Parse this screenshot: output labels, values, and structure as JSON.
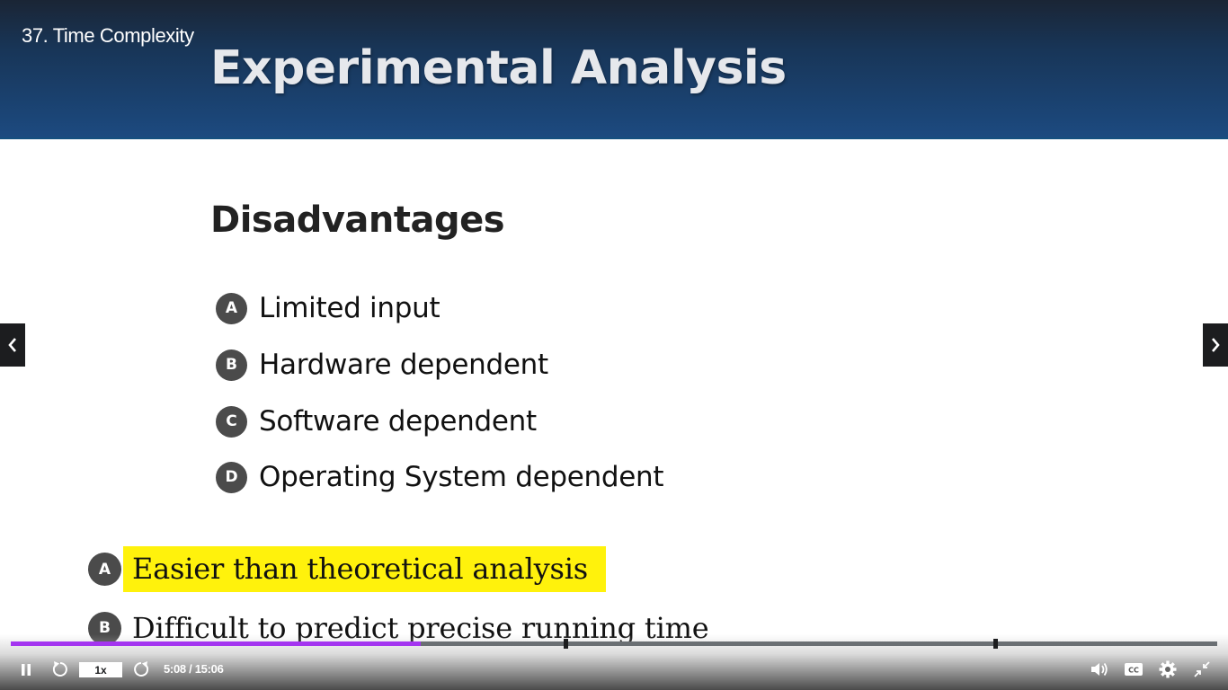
{
  "player": {
    "lecture_title": "37. Time Complexity",
    "playback_speed": "1x",
    "current_time": "5:08",
    "duration": "15:06",
    "time_display": "5:08 / 15:06",
    "progress_fraction": 0.34,
    "accent_color": "#a435f0",
    "bookmark_fractions": [
      0.46,
      0.816
    ]
  },
  "slide": {
    "heading": "Experimental Analysis",
    "section_title": "Disadvantages",
    "list": [
      {
        "badge": "A",
        "text": "Limited input"
      },
      {
        "badge": "B",
        "text": "Hardware dependent"
      },
      {
        "badge": "C",
        "text": "Software dependent"
      },
      {
        "badge": "D",
        "text": "Operating System dependent"
      }
    ],
    "quiz_options": [
      {
        "badge": "A",
        "text": "Easier than theoretical analysis",
        "highlighted": true
      },
      {
        "badge": "B",
        "text": "Difficult to predict precise running time",
        "highlighted": false
      }
    ],
    "highlight_color": "#fff20c"
  },
  "icons": {
    "prev": "chevron-left-icon",
    "next": "chevron-right-icon",
    "pause": "pause-icon",
    "rewind": "rewind-5-icon",
    "forward": "forward-5-icon",
    "volume": "volume-icon",
    "captions": "closed-captions-icon",
    "settings": "gear-icon",
    "exit_fullscreen": "exit-fullscreen-icon"
  }
}
